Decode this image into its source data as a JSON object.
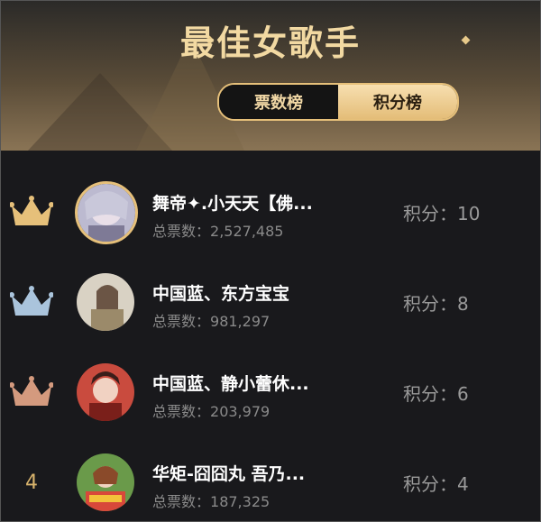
{
  "header": {
    "title": "最佳女歌手",
    "tabs": [
      {
        "label": "票数榜",
        "active": false
      },
      {
        "label": "积分榜",
        "active": true
      }
    ]
  },
  "list": [
    {
      "rank": "1",
      "rank_icon": "gold-crown-icon",
      "name": "舞帝✦.小天天【佛...",
      "votes_label": "总票数：",
      "votes": "2,527,485",
      "score_label": "积分：",
      "score": "10"
    },
    {
      "rank": "2",
      "rank_icon": "silver-crown-icon",
      "name": "中国蓝、东方宝宝",
      "votes_label": "总票数：",
      "votes": "981,297",
      "score_label": "积分：",
      "score": "8"
    },
    {
      "rank": "3",
      "rank_icon": "bronze-crown-icon",
      "name": "中国蓝、静小蕾休...",
      "votes_label": "总票数：",
      "votes": "203,979",
      "score_label": "积分：",
      "score": "6"
    },
    {
      "rank": "4",
      "rank_icon": null,
      "name": "华矩-囧囧丸 吾乃...",
      "votes_label": "总票数：",
      "votes": "187,325",
      "score_label": "积分：",
      "score": "4"
    }
  ],
  "colors": {
    "gold": "#e6c07a",
    "silver": "#aac4dc",
    "bronze": "#d49a7e",
    "text": "#ffffff",
    "muted": "#8a8a8a"
  }
}
